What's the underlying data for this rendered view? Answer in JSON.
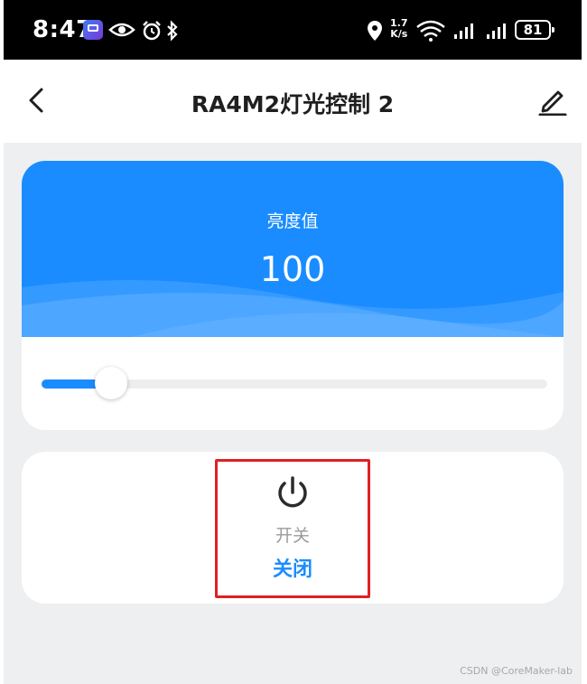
{
  "status_bar": {
    "time": "8:47",
    "net_speed_value": "1.7",
    "net_speed_unit": "K/s",
    "battery": "81",
    "icons": [
      "app-icon",
      "eye-icon",
      "alarm-icon",
      "bluetooth-icon",
      "location-icon",
      "wifi-icon",
      "signal-icon",
      "signal-icon",
      "battery-icon"
    ]
  },
  "nav": {
    "title": "RA4M2灯光控制 2",
    "back_icon": "chevron-left-icon",
    "edit_icon": "pencil-icon"
  },
  "brightness": {
    "label": "亮度值",
    "value": "100",
    "slider_fraction": 0.12
  },
  "switch": {
    "icon": "power-icon",
    "label": "开关",
    "state": "关闭"
  },
  "watermark": "CSDN @CoreMaker-lab",
  "colors": {
    "accent": "#1a8cff",
    "page_bg": "#eeeff1",
    "highlight": "#e02020",
    "muted_text": "#9a9a9a"
  }
}
